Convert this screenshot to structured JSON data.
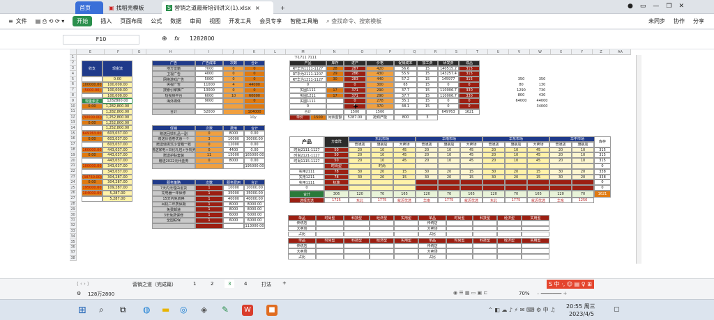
{
  "tabs": {
    "home": "首页",
    "template": "找稻壳模板",
    "file": "营销之道最新培训讲义(1).xlsx",
    "new": "+"
  },
  "window": {
    "right1": "未同步",
    "right2": "协作",
    "right3": "分享"
  },
  "menu": {
    "file": "文件",
    "start": "开始",
    "items": [
      "插入",
      "页面布局",
      "公式",
      "数据",
      "审阅",
      "视图",
      "开发工具",
      "会员专享",
      "智能工具箱"
    ],
    "search": "查找命令、搜索模板"
  },
  "formula": {
    "cellref": "F10",
    "fx": "fx",
    "value": "1282800"
  },
  "cols": [
    "E",
    "F",
    "G",
    "H",
    "I",
    "J",
    "K",
    "L",
    "M",
    "N",
    "O",
    "P",
    "Q",
    "R",
    "S",
    "T",
    "U",
    "V",
    "W",
    "X",
    "Y",
    "Z",
    "AA"
  ],
  "rows": [
    "1",
    "2",
    "3",
    "4",
    "5",
    "6",
    "7",
    "8",
    "9",
    "10",
    "11",
    "12",
    "13",
    "14",
    "15",
    "16",
    "17",
    "18",
    "19",
    "20",
    "21",
    "22",
    "23",
    "24",
    "25",
    "26",
    "27",
    "28",
    "29",
    "30",
    "31",
    "32",
    "33",
    "34",
    "35",
    "36",
    "37",
    "38"
  ],
  "t1": {
    "h1": "收支",
    "h2": "现金流",
    "rows": [
      [
        "",
        "0.00"
      ],
      [
        "100000.00",
        "100,000.00"
      ],
      [
        "(5000.00)",
        "100,000.00"
      ],
      [
        "",
        "100,000.00"
      ],
      [
        "现金余正",
        "1282800.00"
      ],
      [
        "0.00",
        "1,282,800.00"
      ],
      [
        "",
        "1,282,800.00"
      ],
      [
        "(30000.00)",
        "1,252,800.00"
      ],
      [
        "0.00",
        "1,252,800.00"
      ],
      [
        "",
        "1,252,800.00"
      ],
      [
        "(649763.00)",
        "603,037.00"
      ],
      [
        "0.00",
        "603,037.00"
      ],
      [
        "",
        "603,037.00"
      ],
      [
        "(160000.00)",
        "443,037.00"
      ],
      [
        "0.00",
        "443,037.00"
      ],
      [
        "",
        "443,037.00"
      ],
      [
        "(100000.00)",
        "343,037.00"
      ],
      [
        "",
        "343,037.00"
      ],
      [
        "(38750.00)",
        "304,287.00"
      ],
      [
        "0.00",
        "304,287.00"
      ],
      [
        "(195000.00)",
        "109,287.00"
      ],
      [
        "(104000.00)",
        "5,287.00"
      ],
      [
        "",
        "5,287.00"
      ]
    ]
  },
  "t2": {
    "h": [
      "广告",
      "广告成本",
      "次数",
      "合计"
    ],
    "rows": [
      [
        "地方雷霸",
        "7000",
        "0",
        "0"
      ],
      [
        "卫视广告",
        "4000",
        "0",
        "0"
      ],
      [
        "网络游戏广告",
        "5000",
        "0",
        "0"
      ],
      [
        "央视广告",
        "11000",
        "4",
        "44000"
      ],
      [
        "搜索引擎推广",
        "10000",
        "0",
        "0"
      ],
      [
        "短视频平台",
        "6000",
        "10",
        "60000"
      ],
      [
        "海外媒体",
        "9000",
        "",
        "0"
      ],
      [
        "",
        "",
        "",
        ""
      ],
      [
        "合计",
        "52000",
        "",
        "104000"
      ]
    ],
    "note": "10y"
  },
  "t3": {
    "h": [
      "促销",
      "次数",
      "费用",
      "合计"
    ],
    "rows": [
      [
        "赠送回馈礼品一副",
        "0",
        "8000",
        "0.00"
      ],
      [
        "赠送价值卷优惠一个",
        "3",
        "10000",
        "30000.00"
      ],
      [
        "赠送便携式小音箱一枚",
        "0",
        "12000",
        "0.00"
      ],
      [
        "赠送家电+日化礼包+手机壳",
        "0",
        "4400",
        "0.00"
      ],
      [
        "赠送护肤套装",
        "11",
        "15000",
        "165000.00"
      ],
      [
        "赠送2022元代金券",
        "0",
        "8000",
        "0.00"
      ],
      [
        "",
        "",
        "",
        "195000.00"
      ]
    ]
  },
  "t4": {
    "h": [
      "服务策略",
      "次数",
      "服务费用",
      "合计"
    ],
    "rows": [
      [
        "7天内无理由退货",
        "1",
        "10000",
        "10000.00"
      ],
      [
        "充电器一年保修",
        "1",
        "35000",
        "35000.00"
      ],
      [
        "15天内免费换",
        "1",
        "40000",
        "40000.00"
      ],
      [
        "耳机二年质保期",
        "1",
        "8000",
        "8000.00"
      ],
      [
        "免费邮递",
        "1",
        "8000",
        "8000.00"
      ],
      [
        "3年免费保修",
        "1",
        "6000",
        "6000.00"
      ],
      [
        "全国联保",
        "1",
        "6000",
        "6000.00"
      ],
      [
        "",
        "",
        "",
        "113000.00"
      ]
    ]
  },
  "t5": {
    "title": "下1711 7111",
    "h": [
      "产品",
      "库存",
      "进产",
      "价格",
      "促销成本",
      "加工费",
      "研发费",
      "成品"
    ],
    "rows": [
      [
        "RT华为1111-1127",
        "28",
        "287",
        "420",
        "56.6",
        "15",
        "140515.2",
        "315"
      ],
      [
        "RT华为2111-1207",
        "29",
        "286",
        "430",
        "55.9",
        "15",
        "143257.4",
        "315"
      ],
      [
        "RT华为1211-1127",
        "30",
        "283",
        "440",
        "57.2",
        "15",
        "145977",
        "315"
      ],
      [
        "0",
        "",
        "0",
        "300",
        "65",
        "15",
        "0",
        "0"
      ],
      [
        "实图1111",
        "17",
        "371",
        "290",
        "37.7",
        "15",
        "110006.7",
        "330"
      ],
      [
        "实图1211",
        "17",
        "371",
        "290",
        "37.7",
        "15",
        "110006.7",
        "330"
      ],
      [
        "实图1111",
        "",
        "0",
        "278",
        "35.1",
        "15",
        "0",
        "0"
      ],
      [
        "0",
        "",
        "0",
        "370",
        "48.1",
        "15",
        "0",
        "0"
      ],
      [
        "合计",
        "",
        "1500",
        "1500",
        "",
        "",
        "649763",
        "1621"
      ]
    ],
    "foot": [
      "单价",
      "1500",
      "闲余金额",
      "5287.00",
      "抢购产能",
      "800",
      "3"
    ]
  },
  "side": [
    "350",
    "350",
    "80",
    "130",
    "1290",
    "730",
    "800",
    "430",
    "64000",
    "44000",
    "",
    "34000"
  ],
  "t6": {
    "prod": "产品",
    "plan": "方案阵",
    "h2": [
      "东北市场",
      "华南市场",
      "华东市场",
      "华中市场"
    ],
    "h3": [
      "普通店",
      "旗舰店",
      "大卖场"
    ],
    "last": "库存",
    "rows": [
      [
        "时尚2111-1127",
        "50",
        "20",
        "10",
        "45",
        "20",
        "10",
        "45",
        "20",
        "10",
        "45",
        "20",
        "10",
        "315"
      ],
      [
        "时尚2121-1127",
        "50",
        "20",
        "10",
        "45",
        "20",
        "10",
        "45",
        "20",
        "10",
        "45",
        "20",
        "10",
        "315"
      ],
      [
        "时尚1115-1127",
        "50",
        "20",
        "10",
        "45",
        "20",
        "10",
        "45",
        "20",
        "10",
        "45",
        "20",
        "10",
        "315"
      ],
      [
        "",
        "时尚型",
        "",
        "时尚",
        "",
        "",
        "",
        "",
        "",
        "",
        "",
        "",
        "",
        "0"
      ],
      [
        "实用2111",
        "78",
        "30",
        "20",
        "15",
        "30",
        "20",
        "15",
        "30",
        "20",
        "15",
        "30",
        "20",
        "338"
      ],
      [
        "实用1211",
        "78",
        "30",
        "20",
        "15",
        "30",
        "20",
        "15",
        "30",
        "20",
        "15",
        "30",
        "20",
        "338"
      ],
      [
        "实用1111",
        "标准",
        "",
        "",
        "",
        "",
        "",
        "",
        "",
        "",
        "",
        "",
        "",
        "0"
      ],
      [
        "0",
        "",
        "",
        "",
        "",
        "",
        "",
        "",
        "",
        "",
        "",
        "",
        "",
        "0"
      ]
    ],
    "total": [
      "合计",
      "306",
      "120",
      "70",
      "165",
      "120",
      "70",
      "165",
      "120",
      "70",
      "165",
      "120",
      "70",
      "1621"
    ],
    "result": [
      "选择优选",
      "1725",
      "东北",
      "1775",
      "就近优选",
      "华南",
      "1775",
      "就近优选",
      "东北",
      "1775",
      "就近优选",
      "华东",
      "1250"
    ]
  },
  "t7": {
    "h": [
      "单品",
      "时尚型",
      "科技型",
      "经济型",
      "实用型",
      "单品",
      "时尚型",
      "科技型",
      "经济型",
      "实用型"
    ],
    "r": [
      "传统店",
      "大卖场",
      "占比"
    ]
  },
  "sheettabs": [
    "营销之道（完成篇）",
    "1",
    "2",
    "3",
    "4",
    "打法"
  ],
  "statusbar": {
    "left": "128万2800",
    "zoom": "70%"
  },
  "taskbar": {
    "time": "20:55 周三",
    "date": "2023/4/5"
  },
  "colors": {
    "navy": "#1f3a8a",
    "orange": "#e07a10",
    "yellow": "#fff2a8",
    "dark": "#2b2b2b",
    "red": "#9c1f12",
    "green": "#2a8f4c"
  }
}
